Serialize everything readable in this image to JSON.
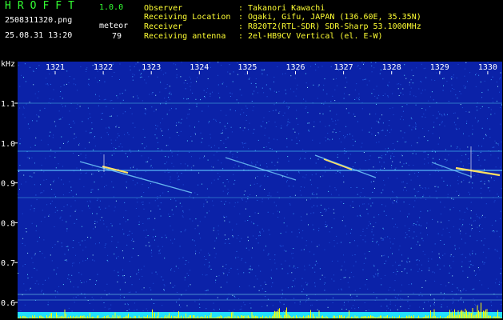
{
  "header": {
    "brand": "HROFFT",
    "version": "1.0.0",
    "filename": "2508311320.png",
    "datetime": "25.08.31 13:20",
    "meteor_label": "meteor",
    "meteor_count": "79"
  },
  "info": {
    "observer_label": "Observer",
    "observer_value": "Takanori Kawachi",
    "location_label": "Receiving Location",
    "location_value": "Ogaki, Gifu, JAPAN (136.60E, 35.35N)",
    "receiver_label": "Receiver",
    "receiver_value": "R820T2(RTL-SDR) SDR-Sharp 53.1000MHz",
    "antenna_label": "Receiving antenna",
    "antenna_value": "2el-HB9CV Vertical (el. E-W)"
  },
  "axis": {
    "y_unit": "kHz",
    "x_ticks": [
      "1321",
      "1322",
      "1323",
      "1324",
      "1325",
      "1326",
      "1327",
      "1328",
      "1329",
      "1330"
    ],
    "y_ticks": [
      "1.1",
      "1.0",
      "0.9",
      "0.8",
      "0.7",
      "0.6"
    ]
  },
  "colors": {
    "background": "#000000",
    "spectrum": "#0b22a8",
    "header_green": "#33ff33",
    "header_yellow": "#ffff33",
    "signal_line": "#60c8ff",
    "meteor_echo": "#ffe060",
    "baseline_cyan": "#22e0ff",
    "baseline_yellow": "#ffff00"
  }
}
